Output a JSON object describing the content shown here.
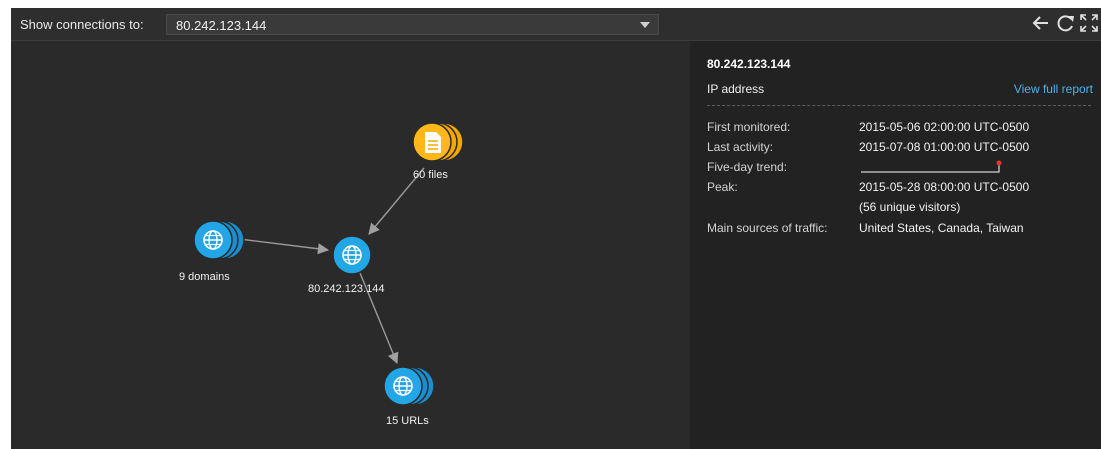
{
  "toolbar": {
    "label": "Show connections to:",
    "selected_value": "80.242.123.144",
    "icons": [
      "back-arrow-icon",
      "refresh-icon",
      "fullscreen-icon"
    ]
  },
  "graph": {
    "nodes": [
      {
        "id": "files",
        "label": "60 files",
        "type": "file",
        "color": "#f5a800"
      },
      {
        "id": "domains",
        "label": "9 domains",
        "type": "globe",
        "color": "#1aa0dd"
      },
      {
        "id": "center",
        "label": "80.242.123.144",
        "type": "globe",
        "color": "#1aa0dd"
      },
      {
        "id": "urls",
        "label": "15 URLs",
        "type": "globe",
        "color": "#1aa0dd"
      }
    ],
    "edges": [
      {
        "from": "files",
        "to": "center"
      },
      {
        "from": "domains",
        "to": "center"
      },
      {
        "from": "center",
        "to": "urls"
      }
    ],
    "edge_color": "#9a9a9a"
  },
  "details": {
    "title": "80.242.123.144",
    "subtitle": "IP address",
    "report_link": "View full report",
    "rows": [
      {
        "key": "First monitored:",
        "value": "2015-05-06 02:00:00 UTC-0500"
      },
      {
        "key": "Last activity:",
        "value": "2015-07-08 01:00:00 UTC-0500"
      },
      {
        "key": "Five-day trend:",
        "value": ""
      },
      {
        "key": "Peak:",
        "value": "2015-05-28 08:00:00 UTC-0500"
      },
      {
        "key": "",
        "value": "(56 unique visitors)"
      },
      {
        "key": "Main sources of traffic:",
        "value": "United States, Canada, Taiwan"
      }
    ],
    "link_color": "#4fb3ea",
    "trend_marker_color": "#e8322b"
  }
}
